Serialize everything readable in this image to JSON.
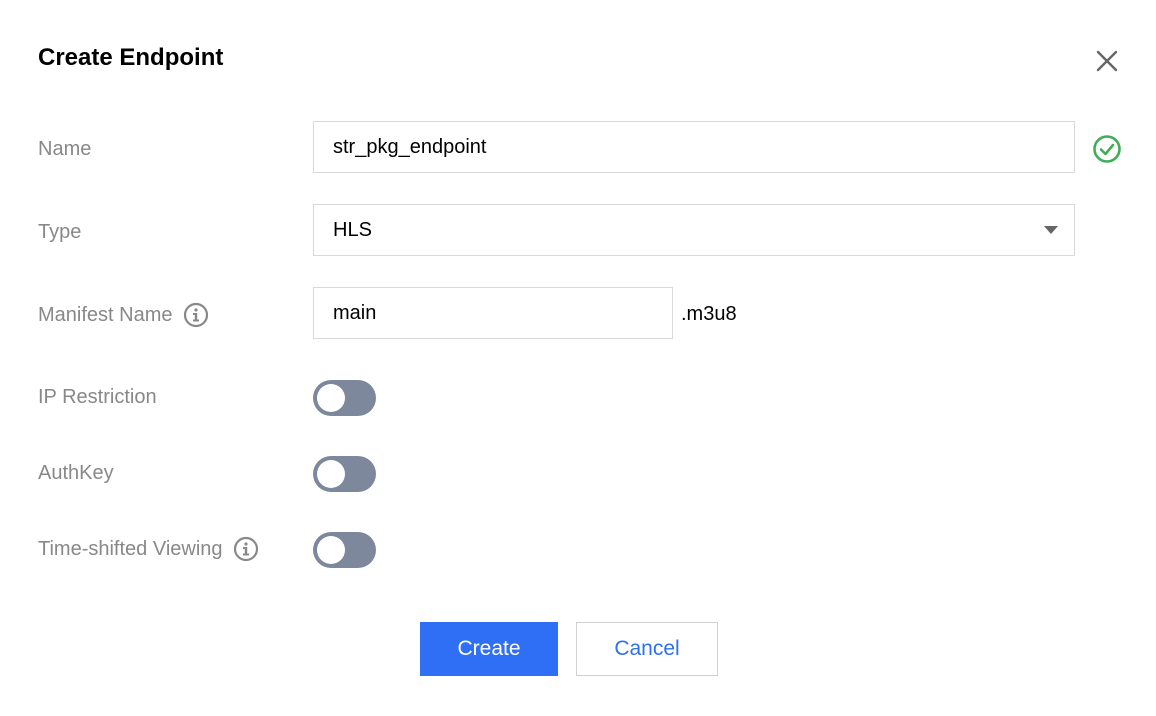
{
  "dialog": {
    "title": "Create Endpoint"
  },
  "form": {
    "name": {
      "label": "Name",
      "value": "str_pkg_endpoint",
      "status": "valid"
    },
    "type": {
      "label": "Type",
      "selected": "HLS"
    },
    "manifest": {
      "label": "Manifest Name",
      "value": "main",
      "suffix": ".m3u8"
    },
    "ip_restriction": {
      "label": "IP Restriction",
      "enabled": false
    },
    "authkey": {
      "label": "AuthKey",
      "enabled": false
    },
    "time_shift": {
      "label": "Time-shifted Viewing",
      "enabled": false
    }
  },
  "actions": {
    "create_label": "Create",
    "cancel_label": "Cancel"
  },
  "icons": {
    "close": "close-icon",
    "valid": "check-circle-icon",
    "info": "info-icon",
    "dropdown": "chevron-down-icon"
  },
  "colors": {
    "primary": "#2f6ff6",
    "valid": "#3fae5a",
    "toggle_off": "#7d889c",
    "label": "#888888"
  }
}
